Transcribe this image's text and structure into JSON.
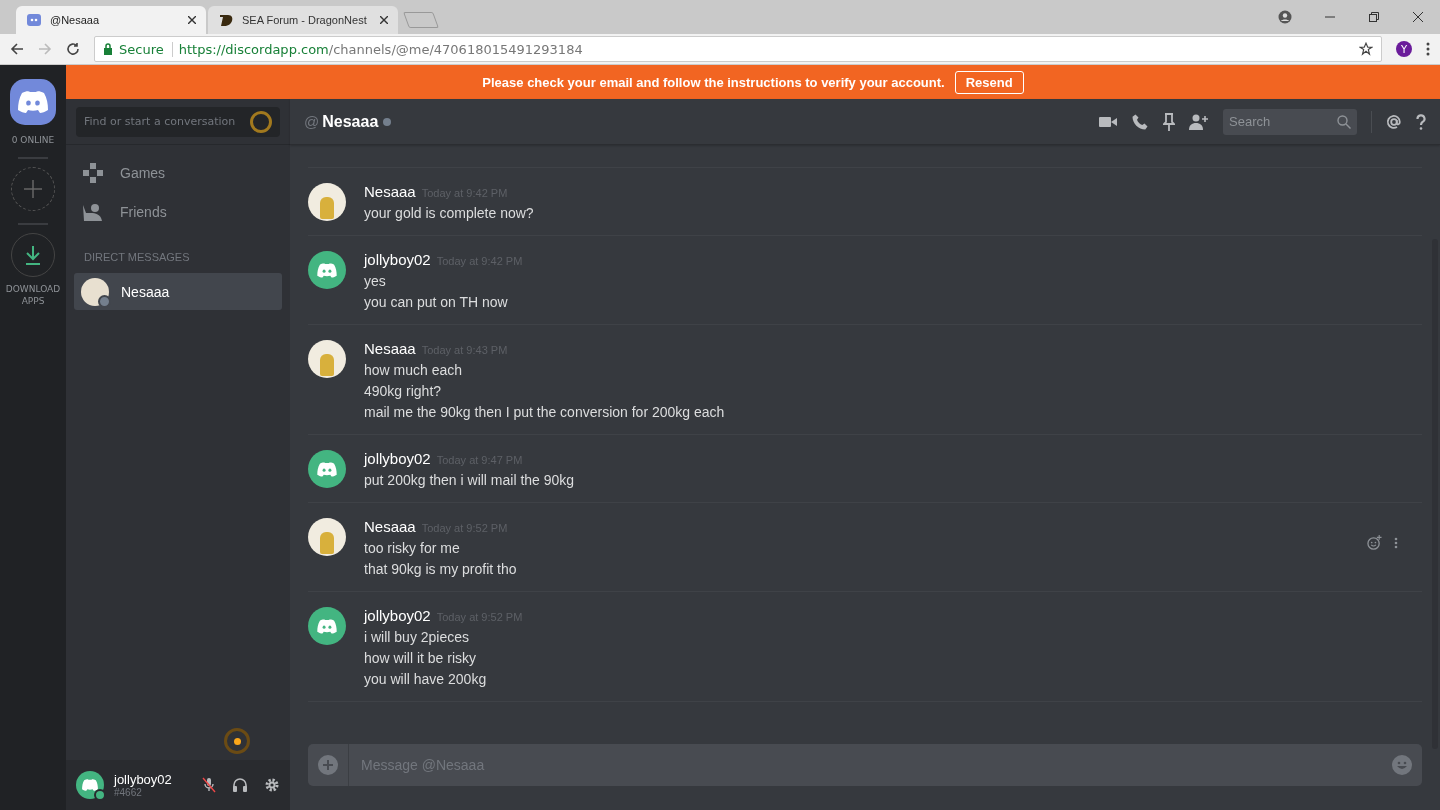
{
  "browser": {
    "tabs": [
      {
        "title": "@Nesaaa",
        "selected": true
      },
      {
        "title": "SEA Forum - DragonNest",
        "selected": false
      }
    ],
    "secure_label": "Secure",
    "url_host": "https://discordapp.com",
    "url_path": "/channels/@me/470618015491293184",
    "profile_initial": "Y"
  },
  "banner": {
    "text": "Please check your email and follow the instructions to verify your account.",
    "button": "Resend"
  },
  "servers": {
    "online": "0 ONLINE",
    "download": "DOWNLOAD APPS"
  },
  "sidebar": {
    "search_placeholder": "Find or start a conversation",
    "nav": [
      {
        "label": "Games"
      },
      {
        "label": "Friends"
      }
    ],
    "dm_heading": "DIRECT MESSAGES",
    "dms": [
      {
        "name": "Nesaaa",
        "selected": true
      }
    ]
  },
  "user": {
    "name": "jollyboy02",
    "tag": "#4662"
  },
  "header": {
    "at": "@",
    "name": "Nesaaa",
    "search_placeholder": "Search"
  },
  "messages": [
    {
      "author": "Nesaaa",
      "kind": "photo",
      "time": "Today at 9:42 PM",
      "lines": [
        "your gold is complete now?"
      ],
      "hovered": false
    },
    {
      "author": "jollyboy02",
      "kind": "default",
      "time": "Today at 9:42 PM",
      "lines": [
        "yes",
        "you can put on TH now"
      ],
      "hovered": false
    },
    {
      "author": "Nesaaa",
      "kind": "photo",
      "time": "Today at 9:43 PM",
      "lines": [
        "how much each",
        "490kg right?",
        "mail me the 90kg then I put the conversion for 200kg each"
      ],
      "hovered": false
    },
    {
      "author": "jollyboy02",
      "kind": "default",
      "time": "Today at 9:47 PM",
      "lines": [
        "put 200kg then i will mail the 90kg"
      ],
      "hovered": false
    },
    {
      "author": "Nesaaa",
      "kind": "photo",
      "time": "Today at 9:52 PM",
      "lines": [
        "too risky for me",
        "that 90kg is my profit tho"
      ],
      "hovered": true
    },
    {
      "author": "jollyboy02",
      "kind": "default",
      "time": "Today at 9:52 PM",
      "lines": [
        "i will buy 2pieces",
        "how will it be risky",
        "you will have 200kg"
      ],
      "hovered": false
    }
  ],
  "composer": {
    "placeholder": "Message @Nesaaa"
  }
}
